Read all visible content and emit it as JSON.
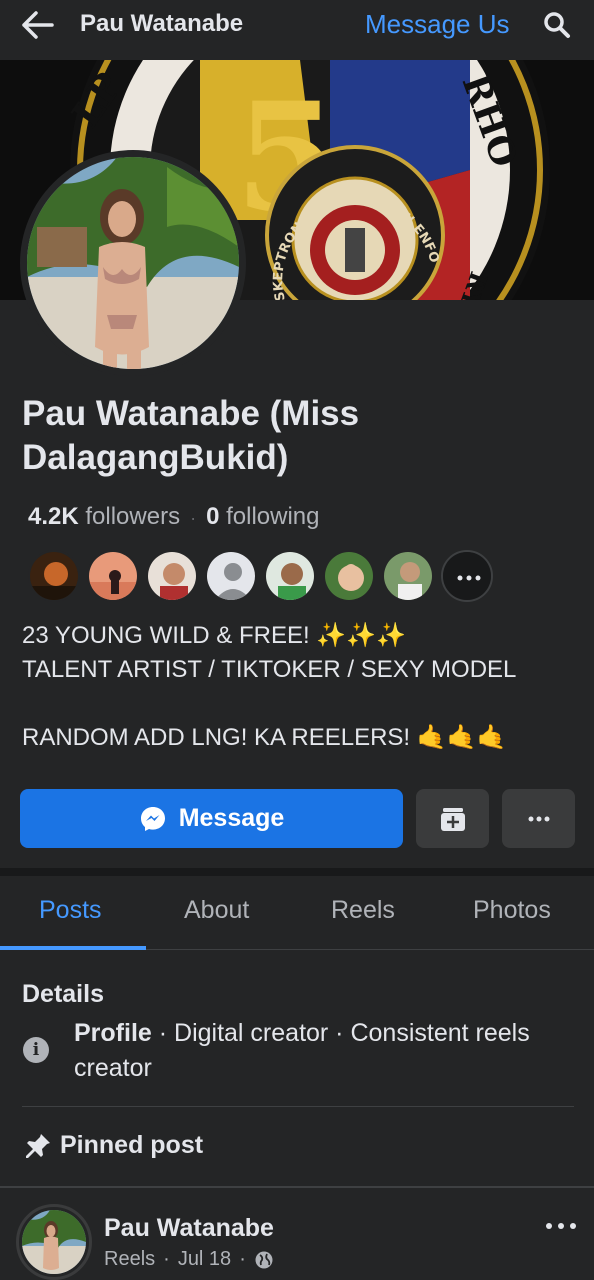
{
  "header": {
    "title": "Pau Watanabe",
    "message_us": "Message Us",
    "back_icon": "arrow-left-icon",
    "search_icon": "search-icon"
  },
  "cover": {
    "seal_text": "SKEPTRON ORDER OF LAW ENFORCEMENT",
    "ring_text_left": "LP",
    "ring_text_right": "RHO",
    "ring_text_bottom": "RY",
    "emblem_number": "5"
  },
  "profile": {
    "name": "Pau Watanabe (Miss DalagangBukid)",
    "followers_count": "4.2K",
    "followers_label": "followers",
    "following_count": "0",
    "following_label": "following",
    "bio_lines": [
      "23 YOUNG WILD & FREE! ✨✨✨",
      "TALENT ARTIST / TIKTOKER / SEXY MODEL",
      "",
      "RANDOM ADD LNG! KA REELERS! 🤙🤙🤙"
    ]
  },
  "actions": {
    "message_label": "Message",
    "message_icon": "messenger-icon",
    "save_icon": "save-icon",
    "more_icon": "more-icon"
  },
  "tabs": [
    {
      "label": "Posts",
      "active": true
    },
    {
      "label": "About",
      "active": false
    },
    {
      "label": "Reels",
      "active": false
    },
    {
      "label": "Photos",
      "active": false
    }
  ],
  "details": {
    "heading": "Details",
    "profile_label": "Profile",
    "profile_text": " · Digital creator · Consistent reels creator"
  },
  "pinned": {
    "label": "Pinned post"
  },
  "post": {
    "author": "Pau Watanabe",
    "type": "Reels",
    "date": "Jul 18",
    "privacy_icon": "globe-icon"
  },
  "colors": {
    "accent": "#4599ff",
    "button_primary": "#1b74e4",
    "background": "#242526",
    "secondary_button": "#3a3b3c"
  }
}
